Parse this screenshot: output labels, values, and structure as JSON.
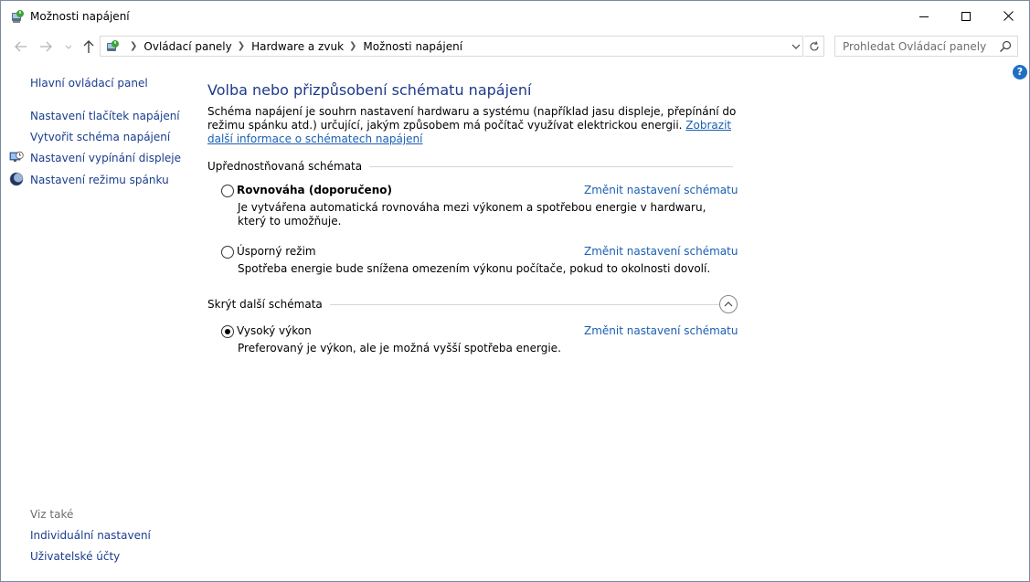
{
  "window": {
    "title": "Možnosti napájení"
  },
  "nav": {
    "breadcrumbs": [
      "Ovládací panely",
      "Hardware a zvuk",
      "Možnosti napájení"
    ],
    "search_placeholder": "Prohledat Ovládací panely"
  },
  "help": {
    "label": "?"
  },
  "sidebar": {
    "home": "Hlavní ovládací panel",
    "items": [
      {
        "label": "Nastavení tlačítek napájení",
        "icon": ""
      },
      {
        "label": "Vytvořit schéma napájení",
        "icon": ""
      },
      {
        "label": "Nastavení vypínání displeje",
        "icon": "monitor-clock-icon"
      },
      {
        "label": "Nastavení režimu spánku",
        "icon": "moon-icon"
      }
    ],
    "see_also_title": "Viz také",
    "see_also": [
      "Individuální nastavení",
      "Uživatelské účty"
    ]
  },
  "main": {
    "heading": "Volba nebo přizpůsobení schématu napájení",
    "intro_text": "Schéma napájení je souhrn nastavení hardwaru a systému (například jasu displeje, přepínání do režimu spánku atd.) určující, jakým způsobem má počítač využívat elektrickou energii. ",
    "intro_link": "Zobrazit další informace o schématech napájení",
    "preferred_title": "Upřednostňovaná schémata",
    "hidden_title": "Skrýt další schémata",
    "change_label": "Změnit nastavení schématu",
    "plans": [
      {
        "name": "Rovnováha (doporučeno)",
        "description": "Je vytvářena automatická rovnováha mezi výkonem a spotřebou energie v hardwaru, který to umožňuje.",
        "selected": false,
        "bold": true
      },
      {
        "name": "Úsporný režim",
        "description": "Spotřeba energie bude snížena omezením výkonu počítače, pokud to okolnosti dovolí.",
        "selected": false,
        "bold": false
      },
      {
        "name": "Vysoký výkon",
        "description": "Preferovaný je výkon, ale je možná vyšší spotřeba energie.",
        "selected": true,
        "bold": false
      }
    ]
  },
  "colors": {
    "link": "#1a3d8f",
    "heading": "#1e3a8a",
    "accent_link": "#1a5fb4"
  }
}
